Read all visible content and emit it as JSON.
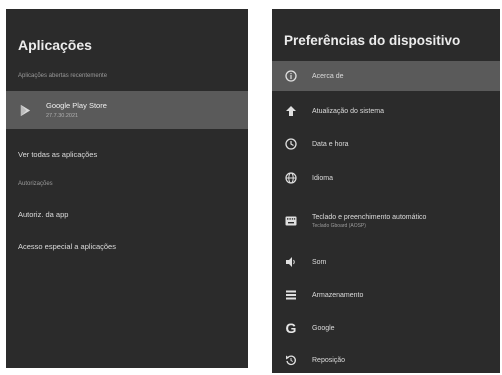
{
  "left_panel": {
    "title": "Aplicações",
    "section_recent": "Aplicações abertas recentemente",
    "recent_app": {
      "name": "Google Play Store",
      "version": "27.7.30.2021"
    },
    "see_all": "Ver todas as aplicações",
    "section_permissions": "Autorizações",
    "app_permissions": "Autoriz. da app",
    "special_access": "Acesso especial a aplicações"
  },
  "right_panel": {
    "title": "Preferências do dispositivo",
    "items": [
      {
        "label": "Acerca de",
        "icon": "info-icon"
      },
      {
        "label": "Atualização do sistema",
        "icon": "arrow-up-icon"
      },
      {
        "label": "Data e hora",
        "icon": "clock-icon"
      },
      {
        "label": "Idioma",
        "icon": "globe-icon"
      },
      {
        "label": "Teclado e preenchimento automático",
        "sub": "Teclado Gboard (AOSP)",
        "icon": "keyboard-icon"
      },
      {
        "label": "Som",
        "icon": "speaker-icon"
      },
      {
        "label": "Armazenamento",
        "icon": "storage-icon"
      },
      {
        "label": "Google",
        "icon": "google-icon"
      },
      {
        "label": "Reposição",
        "icon": "reset-icon"
      }
    ]
  },
  "colors": {
    "panel_bg": "#2b2b2b",
    "selected_bg": "#5a5a5a",
    "text": "#dcdcdc"
  }
}
